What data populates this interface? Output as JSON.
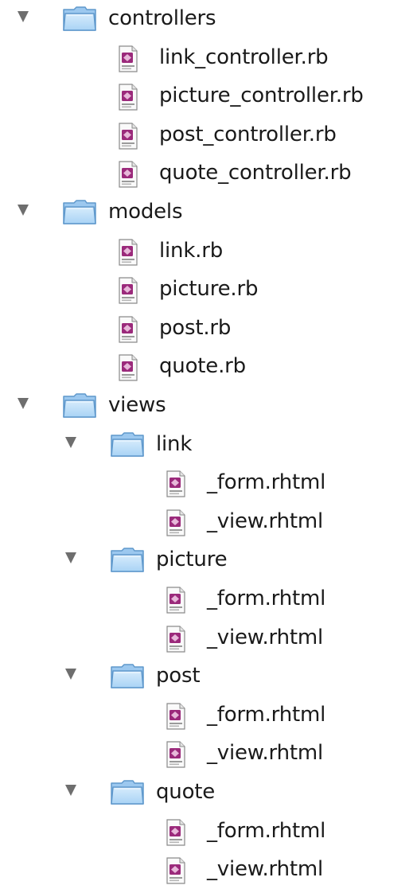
{
  "tree": [
    {
      "name": "controllers",
      "type": "folder",
      "depth": 0,
      "expanded": true
    },
    {
      "name": "link_controller.rb",
      "type": "file",
      "depth": 1
    },
    {
      "name": "picture_controller.rb",
      "type": "file",
      "depth": 1
    },
    {
      "name": "post_controller.rb",
      "type": "file",
      "depth": 1
    },
    {
      "name": "quote_controller.rb",
      "type": "file",
      "depth": 1
    },
    {
      "name": "models",
      "type": "folder",
      "depth": 0,
      "expanded": true
    },
    {
      "name": "link.rb",
      "type": "file",
      "depth": 1
    },
    {
      "name": "picture.rb",
      "type": "file",
      "depth": 1
    },
    {
      "name": "post.rb",
      "type": "file",
      "depth": 1
    },
    {
      "name": "quote.rb",
      "type": "file",
      "depth": 1
    },
    {
      "name": "views",
      "type": "folder",
      "depth": 0,
      "expanded": true
    },
    {
      "name": "link",
      "type": "folder",
      "depth": 1,
      "expanded": true
    },
    {
      "name": "_form.rhtml",
      "type": "file",
      "depth": 2
    },
    {
      "name": "_view.rhtml",
      "type": "file",
      "depth": 2
    },
    {
      "name": "picture",
      "type": "folder",
      "depth": 1,
      "expanded": true
    },
    {
      "name": "_form.rhtml",
      "type": "file",
      "depth": 2
    },
    {
      "name": "_view.rhtml",
      "type": "file",
      "depth": 2
    },
    {
      "name": "post",
      "type": "folder",
      "depth": 1,
      "expanded": true
    },
    {
      "name": "_form.rhtml",
      "type": "file",
      "depth": 2
    },
    {
      "name": "_view.rhtml",
      "type": "file",
      "depth": 2
    },
    {
      "name": "quote",
      "type": "folder",
      "depth": 1,
      "expanded": true
    },
    {
      "name": "_form.rhtml",
      "type": "file",
      "depth": 2
    },
    {
      "name": "_view.rhtml",
      "type": "file",
      "depth": 2
    }
  ],
  "icons": {
    "folder": "folder-icon",
    "file": "ruby-file-icon",
    "disclosure": "disclosure-triangle-expanded-icon"
  },
  "colors": {
    "folder_fill": "#a9d3f5",
    "folder_edge": "#5f98cc",
    "file_badge": "#9b2a7b",
    "disclosure": "#6e6e6e"
  }
}
